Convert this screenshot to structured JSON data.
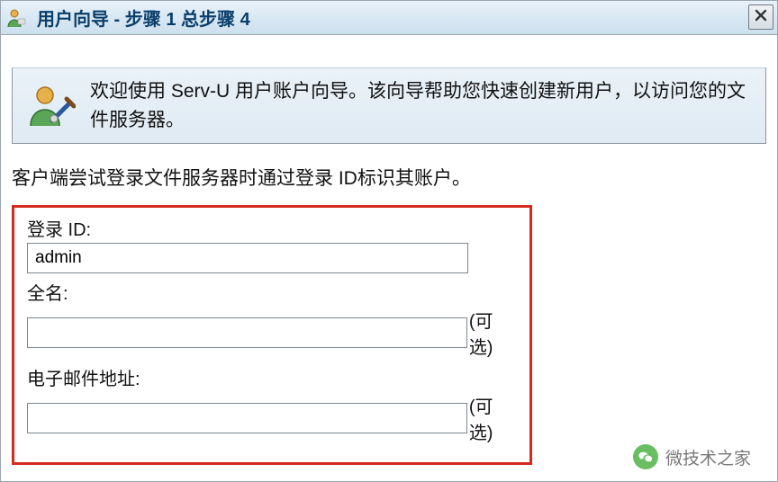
{
  "titlebar": {
    "title": "用户向导 - 步骤 1 总步骤 4"
  },
  "banner": {
    "text": "欢迎使用 Serv-U 用户账户向导。该向导帮助您快速创建新用户，以访问您的文件服务器。"
  },
  "desc": "客户端尝试登录文件服务器时通过登录 ID标识其账户。",
  "form": {
    "login_id": {
      "label": "登录 ID:",
      "value": "admin"
    },
    "full_name": {
      "label": "全名:",
      "value": "",
      "suffix": "(可选)"
    },
    "email": {
      "label": "电子邮件地址:",
      "value": "",
      "suffix": "(可选)"
    }
  },
  "watermark": {
    "text": "微技术之家"
  }
}
